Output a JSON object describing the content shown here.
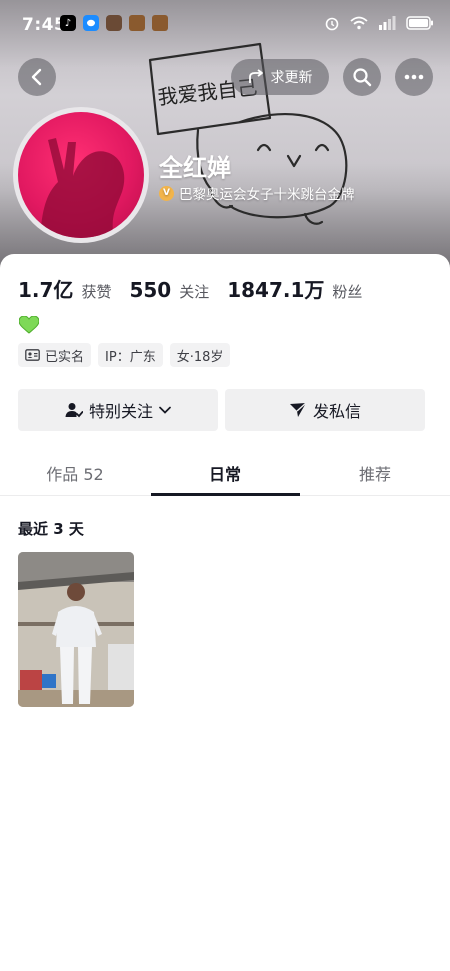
{
  "status_bar": {
    "time": "7:45",
    "notifications": [
      "tiktok-icon",
      "message-icon",
      "app-avatar-icon",
      "app-avatar-icon",
      "app-avatar-icon"
    ],
    "system": [
      "alarm-icon",
      "wifi-icon",
      "signal-icon",
      "battery-icon"
    ]
  },
  "header": {
    "update_pill_label": "求更新",
    "banner_sketch_text": "我爱我自己",
    "banner_face_text": "n w n"
  },
  "profile": {
    "name": "全红婵",
    "verification": "巴黎奥运会女子十米跳台金牌"
  },
  "stats": [
    {
      "value": "1.7亿",
      "label": "获赞"
    },
    {
      "value": "550",
      "label": "关注"
    },
    {
      "value": "1847.1万",
      "label": "粉丝"
    }
  ],
  "bio_emoji": "💚",
  "tags": [
    {
      "icon": "id-card-icon",
      "label": "已实名"
    },
    {
      "icon": "",
      "label": "IP：广东"
    },
    {
      "icon": "",
      "label": "女·18岁"
    }
  ],
  "actions": {
    "follow_label": "特别关注",
    "message_label": "发私信"
  },
  "tabs": [
    {
      "label": "作品 52",
      "active": false
    },
    {
      "label": "日常",
      "active": true
    },
    {
      "label": "推荐",
      "active": false
    }
  ],
  "section": {
    "title": "最近 3 天"
  },
  "colors": {
    "text_primary": "#161823",
    "text_secondary": "#57585f",
    "avatar_pink": "#e21961",
    "verify_gold": "#f2b44a"
  }
}
